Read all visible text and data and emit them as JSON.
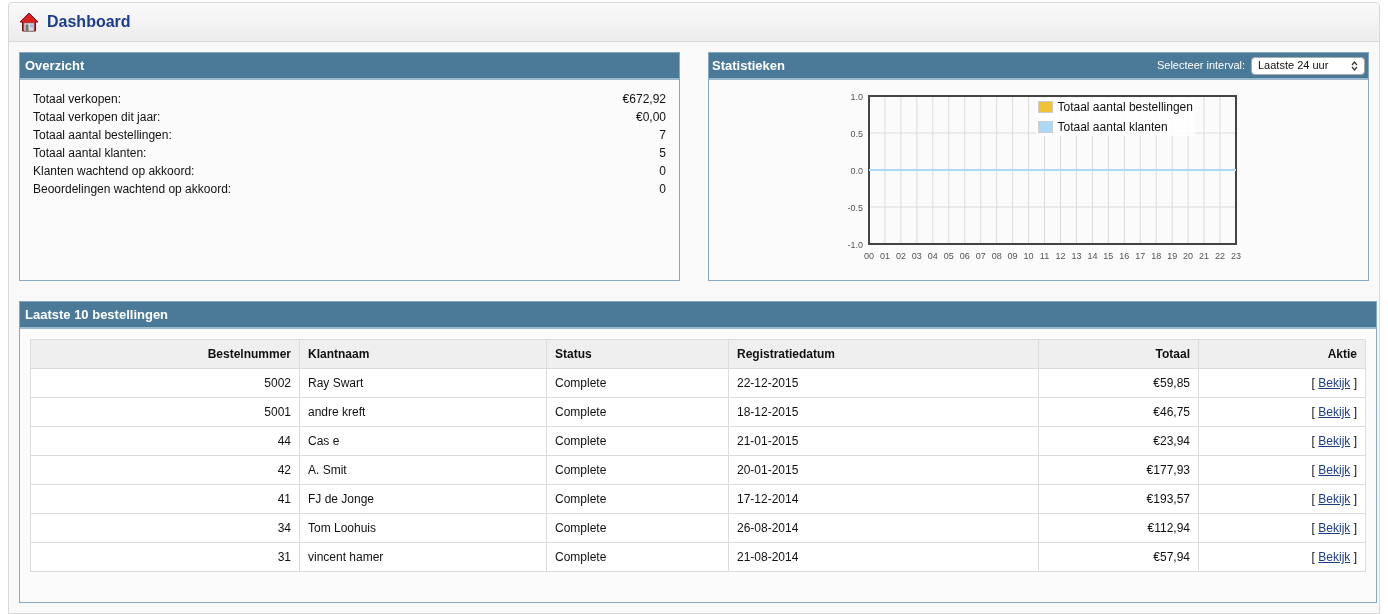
{
  "page": {
    "title": "Dashboard"
  },
  "overview": {
    "title": "Overzicht",
    "items": [
      {
        "label": "Totaal verkopen:",
        "value": "€672,92"
      },
      {
        "label": "Totaal verkopen dit jaar:",
        "value": "€0,00"
      },
      {
        "label": "Totaal aantal bestellingen:",
        "value": "7"
      },
      {
        "label": "Totaal aantal klanten:",
        "value": "5"
      },
      {
        "label": "Klanten wachtend op akkoord:",
        "value": "0"
      },
      {
        "label": "Beoordelingen wachtend op akkoord:",
        "value": "0"
      }
    ]
  },
  "statistics": {
    "title": "Statistieken",
    "interval_label": "Selecteer interval:",
    "interval_value": "Laatste 24 uur",
    "chart_data": {
      "type": "line",
      "categories": [
        "00",
        "01",
        "02",
        "03",
        "04",
        "05",
        "06",
        "07",
        "08",
        "09",
        "10",
        "11",
        "12",
        "13",
        "14",
        "15",
        "16",
        "17",
        "18",
        "19",
        "20",
        "21",
        "22",
        "23"
      ],
      "series": [
        {
          "name": "Totaal aantal bestellingen",
          "color": "#f1c232",
          "values": [
            null,
            null,
            null,
            null,
            null,
            null,
            null,
            null,
            null,
            null,
            null,
            null,
            null,
            null,
            null,
            null,
            null,
            null,
            null,
            null,
            null,
            null,
            null,
            null
          ]
        },
        {
          "name": "Totaal aantal klanten",
          "color": "#add8f7",
          "values": [
            0,
            0,
            0,
            0,
            0,
            0,
            0,
            0,
            0,
            0,
            0,
            0,
            0,
            0,
            0,
            0,
            0,
            0,
            0,
            0,
            0,
            0,
            0,
            0
          ]
        }
      ],
      "ylim": [
        -1,
        1
      ],
      "grid": true,
      "legend": true,
      "yticks": [
        {
          "value": 1,
          "label": "1.0"
        },
        {
          "value": 0.5,
          "label": "0.5"
        },
        {
          "value": 0,
          "label": "0.0"
        },
        {
          "value": -0.5,
          "label": "-0.5"
        },
        {
          "value": -1,
          "label": "-1.0"
        }
      ]
    }
  },
  "orders": {
    "title": "Laatste 10 bestellingen",
    "columns": [
      {
        "label": "Bestelnummer"
      },
      {
        "label": "Klantnaam"
      },
      {
        "label": "Status"
      },
      {
        "label": "Registratiedatum"
      },
      {
        "label": "Totaal"
      },
      {
        "label": "Aktie"
      }
    ],
    "rows": [
      {
        "number": "5002",
        "customer": "Ray Swart",
        "status": "Complete",
        "date": "22-12-2015",
        "total": "€59,85",
        "action": {
          "open": "[",
          "link": "Bekijk",
          "close": "]"
        }
      },
      {
        "number": "5001",
        "customer": "andre kreft",
        "status": "Complete",
        "date": "18-12-2015",
        "total": "€46,75",
        "action": {
          "open": "[",
          "link": "Bekijk",
          "close": "]"
        }
      },
      {
        "number": "44",
        "customer": "Cas e",
        "status": "Complete",
        "date": "21-01-2015",
        "total": "€23,94",
        "action": {
          "open": "[",
          "link": "Bekijk",
          "close": "]"
        }
      },
      {
        "number": "42",
        "customer": "A. Smit",
        "status": "Complete",
        "date": "20-01-2015",
        "total": "€177,93",
        "action": {
          "open": "[",
          "link": "Bekijk",
          "close": "]"
        }
      },
      {
        "number": "41",
        "customer": "FJ de Jonge",
        "status": "Complete",
        "date": "17-12-2014",
        "total": "€193,57",
        "action": {
          "open": "[",
          "link": "Bekijk",
          "close": "]"
        }
      },
      {
        "number": "34",
        "customer": "Tom Loohuis",
        "status": "Complete",
        "date": "26-08-2014",
        "total": "€112,94",
        "action": {
          "open": "[",
          "link": "Bekijk",
          "close": "]"
        }
      },
      {
        "number": "31",
        "customer": "vincent hamer",
        "status": "Complete",
        "date": "21-08-2014",
        "total": "€57,94",
        "action": {
          "open": "[",
          "link": "Bekijk",
          "close": "]"
        }
      }
    ]
  }
}
